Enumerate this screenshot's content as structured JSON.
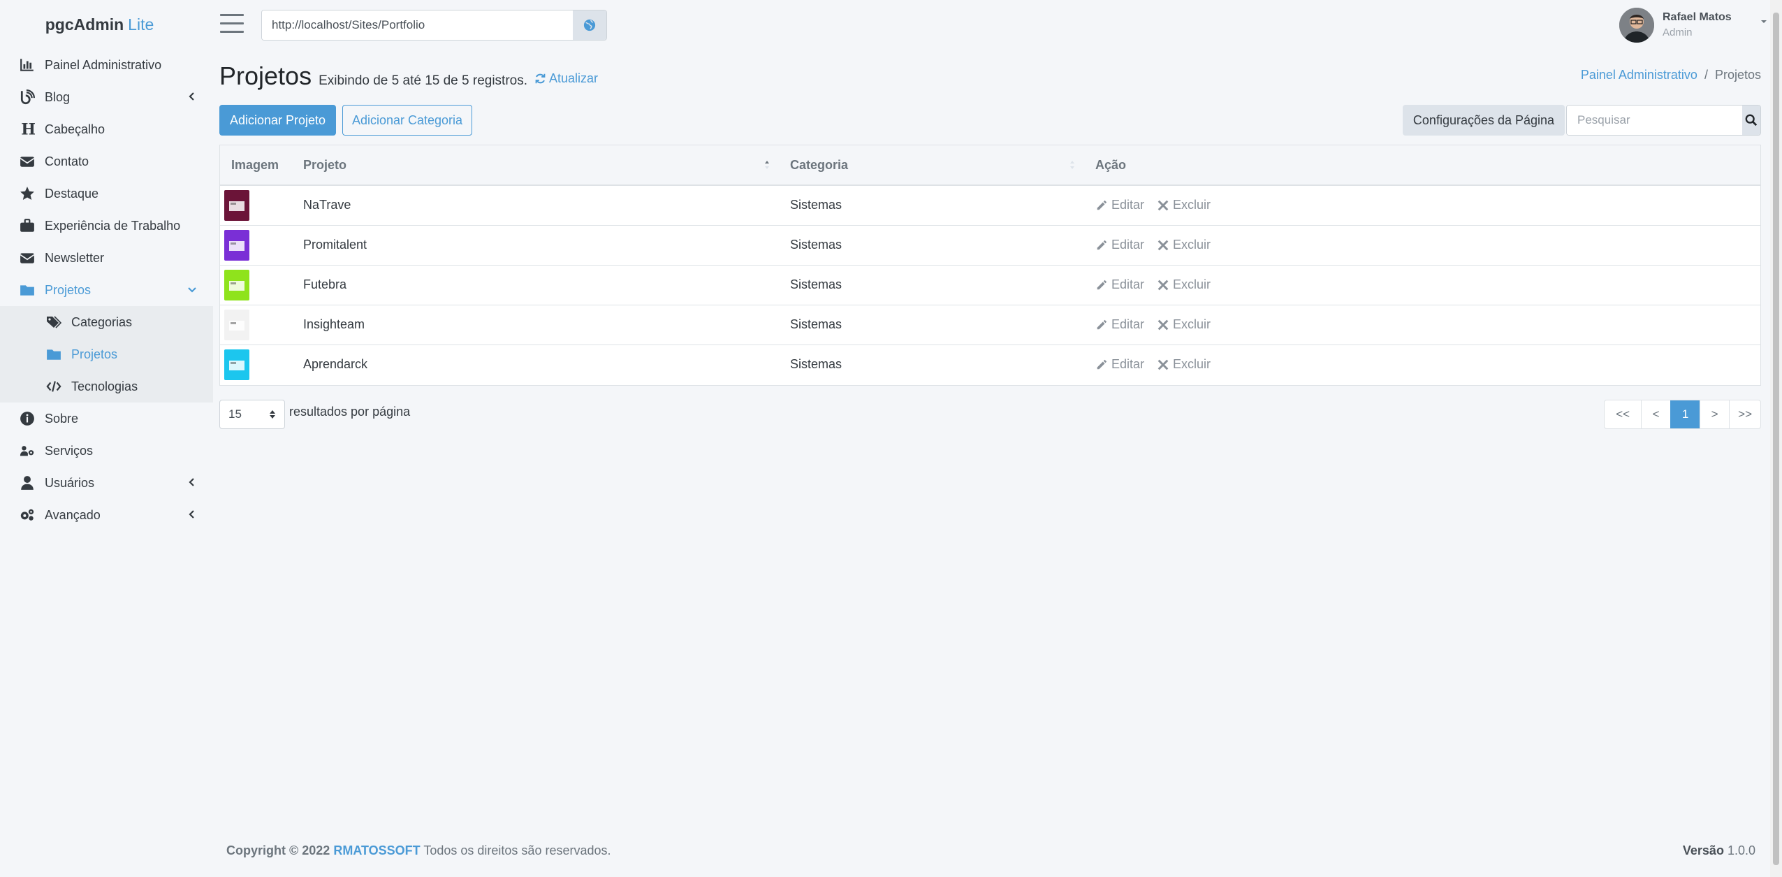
{
  "brand": {
    "name": "pgcAdmin",
    "suffix": "Lite"
  },
  "sidebar": {
    "items": [
      {
        "label": "Painel Administrativo",
        "icon": "chart-icon"
      },
      {
        "label": "Blog",
        "icon": "blog-icon",
        "has_arrow": true
      },
      {
        "label": "Cabeçalho",
        "icon": "heading-icon"
      },
      {
        "label": "Contato",
        "icon": "envelope-icon"
      },
      {
        "label": "Destaque",
        "icon": "star-icon"
      },
      {
        "label": "Experiência de Trabalho",
        "icon": "briefcase-icon"
      },
      {
        "label": "Newsletter",
        "icon": "envelope-icon"
      },
      {
        "label": "Projetos",
        "icon": "folder-icon",
        "expanded": true
      },
      {
        "label": "Sobre",
        "icon": "info-icon"
      },
      {
        "label": "Serviços",
        "icon": "users-cog-icon"
      },
      {
        "label": "Usuários",
        "icon": "user-icon",
        "has_arrow": true
      },
      {
        "label": "Avançado",
        "icon": "cogs-icon",
        "has_arrow": true
      }
    ],
    "subitems": [
      {
        "label": "Categorias",
        "icon": "tags-icon"
      },
      {
        "label": "Projetos",
        "icon": "folder-icon",
        "active": true
      },
      {
        "label": "Tecnologias",
        "icon": "code-icon"
      }
    ]
  },
  "topbar": {
    "url": "http://localhost/Sites/Portfolio",
    "user_name": "Rafael Matos",
    "user_role": "Admin"
  },
  "page": {
    "title": "Projetos",
    "info": "Exibindo de 5 até 15 de 5 registros.",
    "refresh_label": "Atualizar",
    "breadcrumb": [
      "Painel Administrativo",
      "Projetos"
    ],
    "breadcrumb_sep": "/",
    "add_project_label": "Adicionar Projeto",
    "add_category_label": "Adicionar Categoria",
    "config_label": "Configurações da Página",
    "search_placeholder": "Pesquisar"
  },
  "table": {
    "columns": [
      "Imagem",
      "Projeto",
      "Categoria",
      "Ação"
    ],
    "edit_label": "Editar",
    "delete_label": "Excluir",
    "rows": [
      {
        "project": "NaTrave",
        "category": "Sistemas",
        "thumb_color": "#6b1438"
      },
      {
        "project": "Promitalent",
        "category": "Sistemas",
        "thumb_color": "#7a2fd6"
      },
      {
        "project": "Futebra",
        "category": "Sistemas",
        "thumb_color": "#8fe31c"
      },
      {
        "project": "Insighteam",
        "category": "Sistemas",
        "thumb_color": "#f2f2f2"
      },
      {
        "project": "Aprendarck",
        "category": "Sistemas",
        "thumb_color": "#1cc6ee"
      }
    ]
  },
  "pagination": {
    "per_page": "15",
    "per_page_label": "resultados por página",
    "buttons": [
      "<<",
      "<",
      "1",
      ">",
      ">>"
    ],
    "current": "1"
  },
  "footer": {
    "copyright": "Copyright © 2022",
    "company": "RMATOSSOFT",
    "rights": "Todos os direitos são reservados.",
    "version_label": "Versão",
    "version": "1.0.0"
  },
  "colors": {
    "accent": "#4a9ad6",
    "background": "#f4f6f9"
  }
}
